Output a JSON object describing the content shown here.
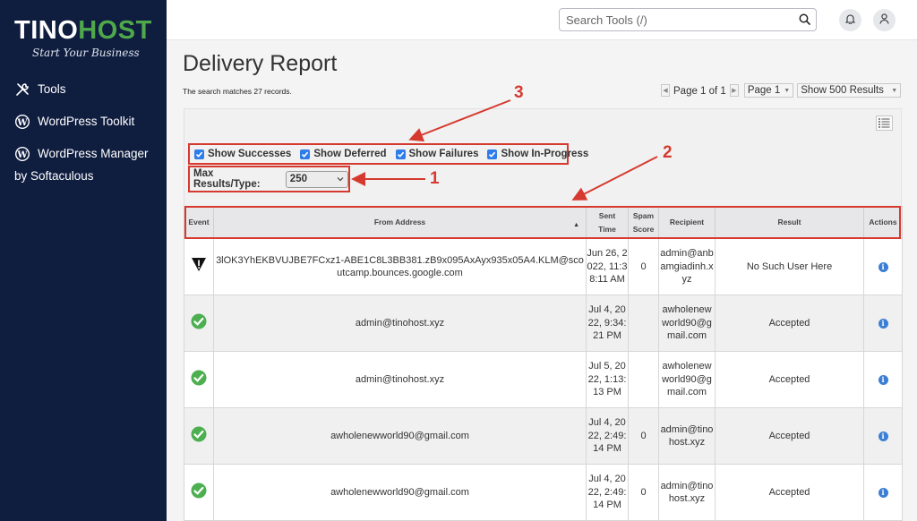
{
  "brand": {
    "name_part1": "TINO",
    "name_part2": "HOST",
    "tagline": "Start Your Business"
  },
  "sidebar": {
    "items": [
      {
        "label": "Tools",
        "icon": "tools-icon"
      },
      {
        "label": "WordPress Toolkit",
        "icon": "wordpress-icon"
      },
      {
        "label": "WordPress Manager",
        "sub": "by Softaculous",
        "icon": "wordpress-icon"
      }
    ]
  },
  "header": {
    "search_placeholder": "Search Tools (/)"
  },
  "page": {
    "title": "Delivery Report",
    "match_text": "The search matches 27 records."
  },
  "pager": {
    "page_info": "Page 1 of 1",
    "page_select": "Page 1",
    "results_select": "Show 500 Results"
  },
  "filters": {
    "show_successes": "Show Successes",
    "show_deferred": "Show Deferred",
    "show_failures": "Show Failures",
    "show_in_progress": "Show In-Progress",
    "max_results_label": "Max Results/Type:",
    "max_results_value": "250"
  },
  "table": {
    "columns": [
      "Event",
      "From Address",
      "Sent Time",
      "Spam Score",
      "Recipient",
      "Result",
      "Actions"
    ],
    "col_sent_1": "Sent",
    "col_sent_2": "Time",
    "col_spam_1": "Spam",
    "col_spam_2": "Score",
    "rows": [
      {
        "event": "failure",
        "from": "3lOK3YhEKBVUJBE7FCxz1-ABE1C8L3BB381.zB9x095AxAyx935x05A4.KLM@scoutcamp.bounces.google.com",
        "sent": "Jun 26, 2022, 11:38:11 AM",
        "spam": "0",
        "recipient": "admin@anbamgiadinh.xyz",
        "result": "No Such User Here"
      },
      {
        "event": "success",
        "from": "admin@tinohost.xyz",
        "sent": "Jul 4, 2022, 9:34:21 PM",
        "spam": "",
        "recipient": "awholenewworld90@gmail.com",
        "result": "Accepted"
      },
      {
        "event": "success",
        "from": "admin@tinohost.xyz",
        "sent": "Jul 5, 2022, 1:13:13 PM",
        "spam": "",
        "recipient": "awholenewworld90@gmail.com",
        "result": "Accepted"
      },
      {
        "event": "success",
        "from": "awholenewworld90@gmail.com",
        "sent": "Jul 4, 2022, 2:49:14 PM",
        "spam": "0",
        "recipient": "admin@tinohost.xyz",
        "result": "Accepted"
      },
      {
        "event": "success",
        "from": "awholenewworld90@gmail.com",
        "sent": "Jul 4, 2022, 2:49:14 PM",
        "spam": "0",
        "recipient": "admin@tinohost.xyz",
        "result": "Accepted"
      }
    ]
  },
  "annotations": {
    "n1": "1",
    "n2": "2",
    "n3": "3"
  },
  "colors": {
    "sidebar": "#0f1d3f",
    "brand_green": "#4fa84a",
    "annotation_red": "#d63a2f",
    "checkbox_blue": "#2f7dea",
    "success_green": "#4caf50"
  }
}
